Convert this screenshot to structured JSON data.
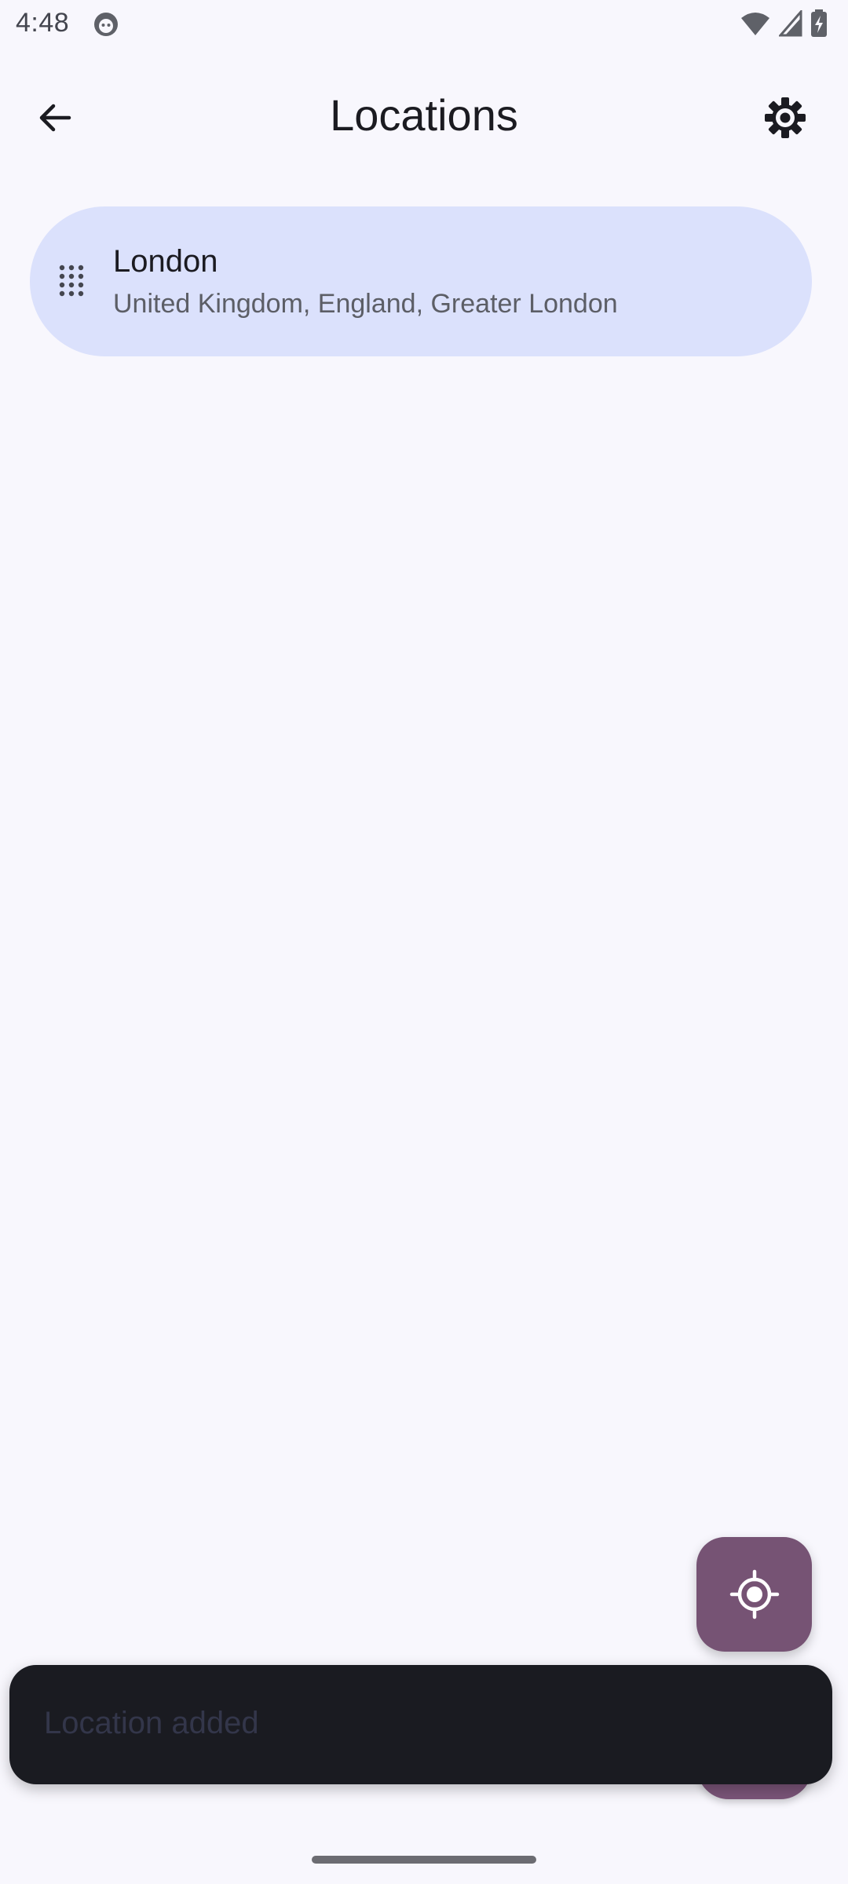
{
  "status_bar": {
    "time": "4:48",
    "icons": [
      "app-notification-icon",
      "wifi-icon",
      "signal-icon",
      "battery-charging-icon"
    ]
  },
  "top_bar": {
    "title": "Locations",
    "back_icon": "arrow-back-icon",
    "settings_icon": "gear-icon"
  },
  "locations": [
    {
      "name": "London",
      "detail": "United Kingdom, England, Greater London",
      "handle_icon": "drag-handle-icon"
    }
  ],
  "fab": {
    "icon": "my-location-icon"
  },
  "snackbar": {
    "message": "Location added"
  },
  "colors": {
    "background": "#f8f7fd",
    "card": "#dbe1fc",
    "fab": "#765374",
    "snackbar": "#1a1b21"
  }
}
